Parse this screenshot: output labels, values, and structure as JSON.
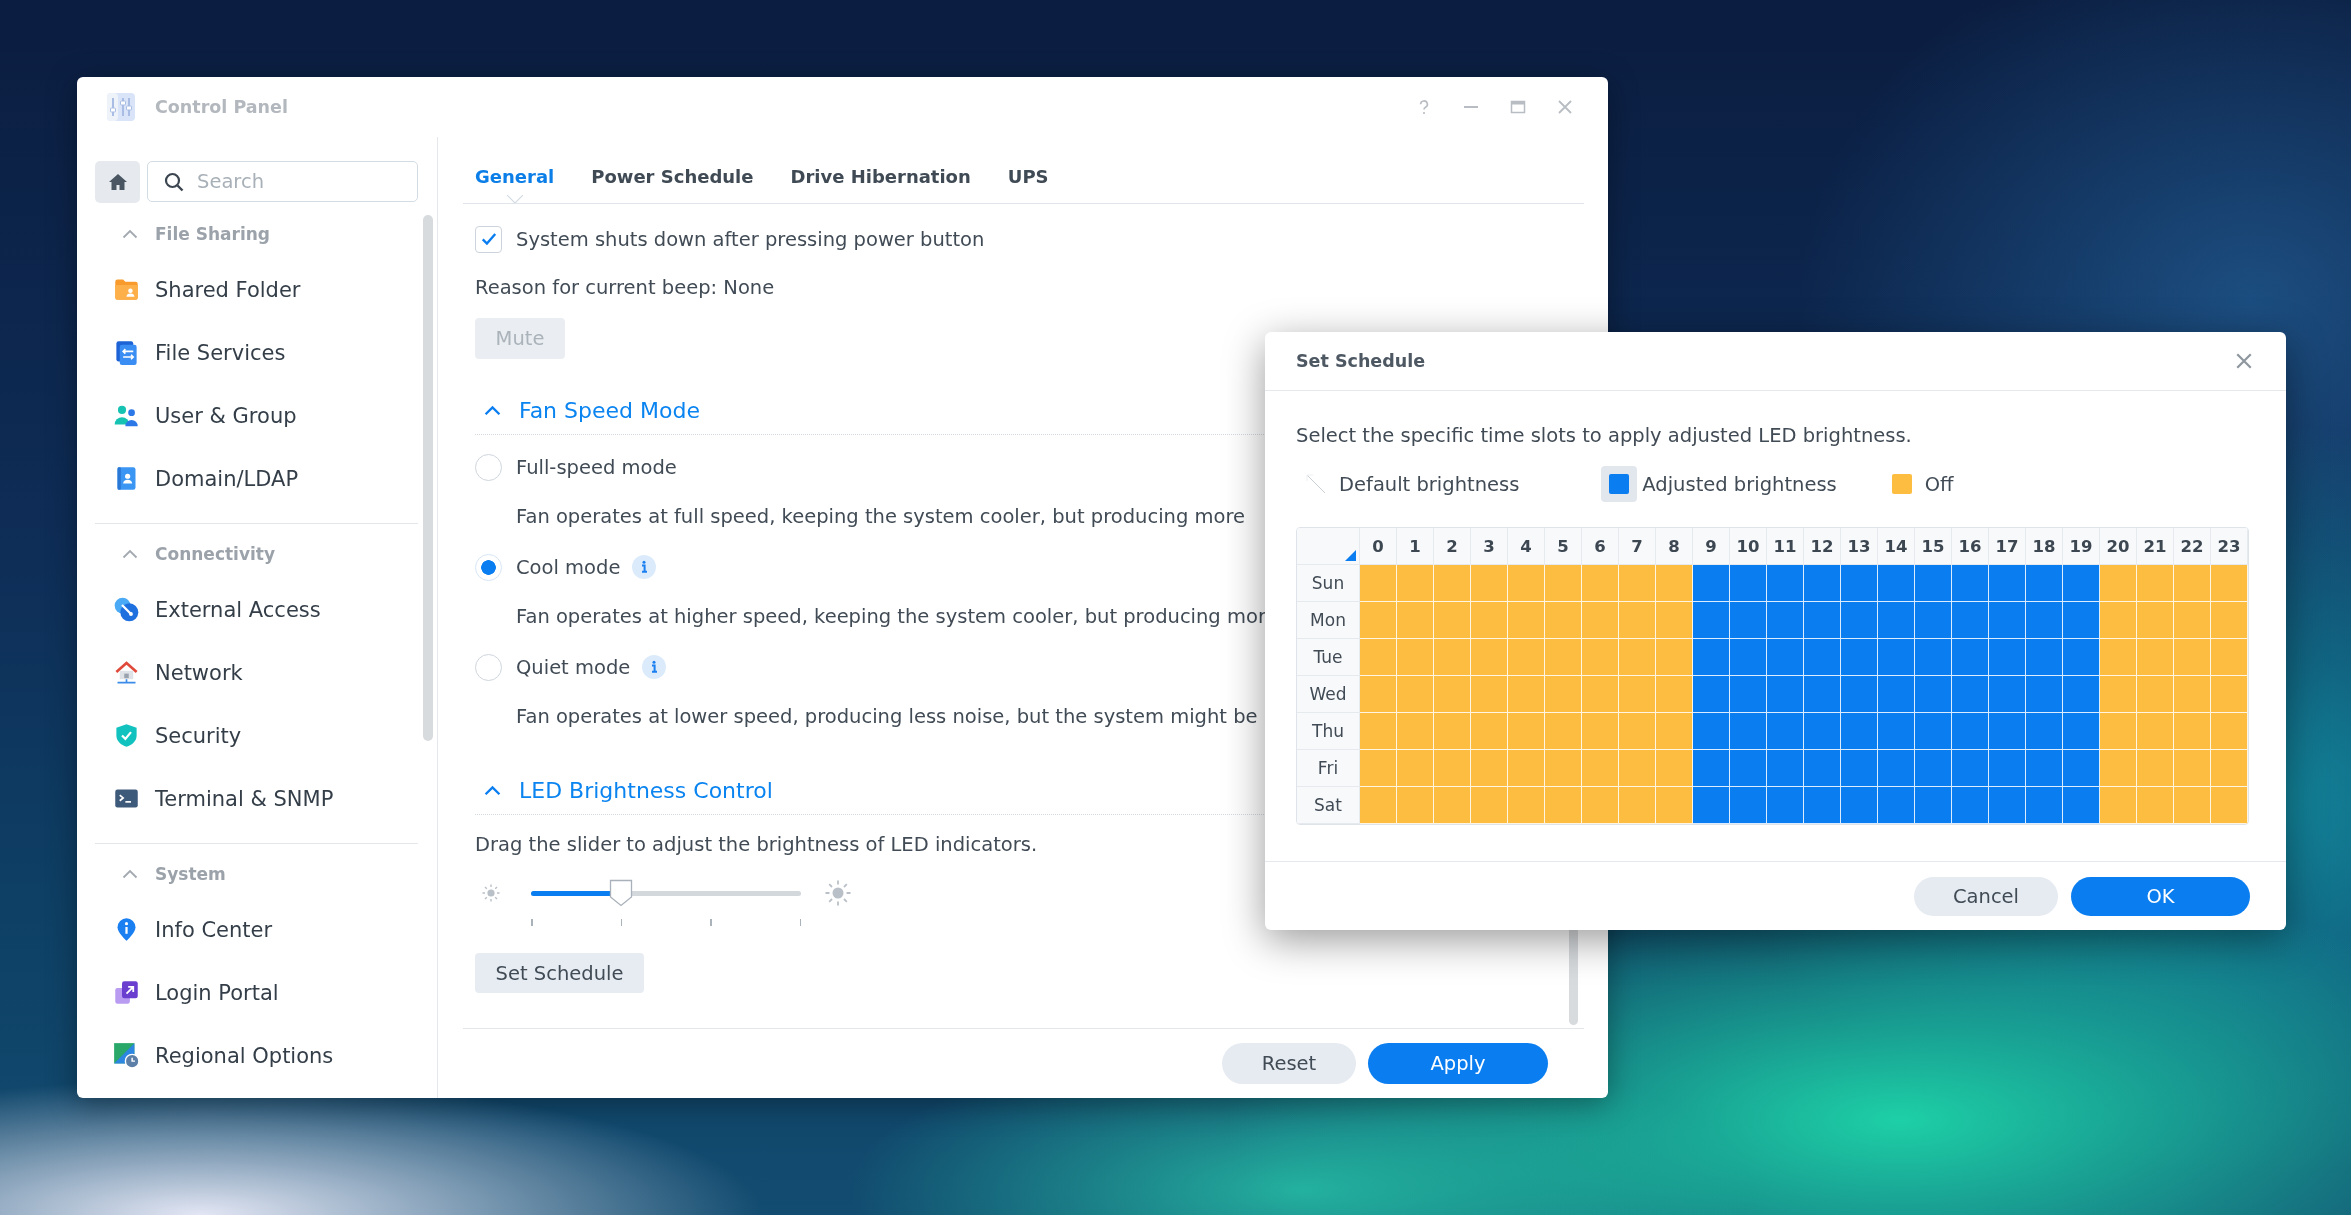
{
  "window": {
    "title": "Control Panel"
  },
  "sidebar": {
    "search": {
      "placeholder": "Search"
    },
    "groups": [
      {
        "label": "File Sharing",
        "expanded": true,
        "items": [
          {
            "label": "Shared Folder",
            "selected": false
          },
          {
            "label": "File Services",
            "selected": false
          },
          {
            "label": "User & Group",
            "selected": false
          },
          {
            "label": "Domain/LDAP",
            "selected": false
          }
        ]
      },
      {
        "label": "Connectivity",
        "expanded": true,
        "items": [
          {
            "label": "External Access",
            "selected": false
          },
          {
            "label": "Network",
            "selected": false
          },
          {
            "label": "Security",
            "selected": false
          },
          {
            "label": "Terminal & SNMP",
            "selected": false
          }
        ]
      },
      {
        "label": "System",
        "expanded": true,
        "items": [
          {
            "label": "Info Center",
            "selected": false
          },
          {
            "label": "Login Portal",
            "selected": false
          },
          {
            "label": "Regional Options",
            "selected": false
          }
        ]
      }
    ]
  },
  "tabs": [
    {
      "label": "General",
      "selected": true
    },
    {
      "label": "Power Schedule",
      "selected": false
    },
    {
      "label": "Drive Hibernation",
      "selected": false
    },
    {
      "label": "UPS",
      "selected": false
    }
  ],
  "general": {
    "power_button": {
      "label": "System shuts down after pressing power button",
      "checked": true
    },
    "beep_reason": "Reason for current beep: None",
    "mute_button": {
      "label": "Mute",
      "disabled": true
    },
    "fan_speed": {
      "title": "Fan Speed Mode",
      "expanded": true,
      "options": [
        {
          "label": "Full-speed mode",
          "info": false,
          "selected": false,
          "description": "Fan operates at full speed, keeping the system cooler, but producing more"
        },
        {
          "label": "Cool mode",
          "info": true,
          "selected": true,
          "description": "Fan operates at higher speed, keeping the system cooler, but producing mor"
        },
        {
          "label": "Quiet mode",
          "info": true,
          "selected": false,
          "description": "Fan operates at lower speed, producing less noise, but the system might be"
        }
      ]
    },
    "led": {
      "title": "LED Brightness Control",
      "expanded": true,
      "hint": "Drag the slider to adjust the brightness of LED indicators.",
      "slider": {
        "level": 0.333
      },
      "schedule_button": "Set Schedule"
    }
  },
  "footer_buttons": [
    {
      "label": "Reset",
      "kind": "secondary"
    },
    {
      "label": "Apply",
      "kind": "primary"
    }
  ],
  "dialog": {
    "title": "Set Schedule",
    "instructions": "Select the specific time slots to apply adjusted LED brightness.",
    "legend": [
      {
        "label": "Default brightness",
        "kind": "default",
        "selected": false
      },
      {
        "label": "Adjusted brightness",
        "kind": "adjusted",
        "selected": true
      },
      {
        "label": "Off",
        "kind": "off",
        "selected": false
      }
    ],
    "hours": [
      "0",
      "1",
      "2",
      "3",
      "4",
      "5",
      "6",
      "7",
      "8",
      "9",
      "10",
      "11",
      "12",
      "13",
      "14",
      "15",
      "16",
      "17",
      "18",
      "19",
      "20",
      "21",
      "22",
      "23"
    ],
    "rows": [
      {
        "day": "Sun",
        "slots": [
          {
            "kind": "off"
          },
          {
            "kind": "off"
          },
          {
            "kind": "off"
          },
          {
            "kind": "off"
          },
          {
            "kind": "off"
          },
          {
            "kind": "off"
          },
          {
            "kind": "off"
          },
          {
            "kind": "off"
          },
          {
            "kind": "off"
          },
          {
            "kind": "adjusted"
          },
          {
            "kind": "adjusted"
          },
          {
            "kind": "adjusted"
          },
          {
            "kind": "adjusted"
          },
          {
            "kind": "adjusted"
          },
          {
            "kind": "adjusted"
          },
          {
            "kind": "adjusted"
          },
          {
            "kind": "adjusted"
          },
          {
            "kind": "adjusted"
          },
          {
            "kind": "adjusted"
          },
          {
            "kind": "adjusted"
          },
          {
            "kind": "off"
          },
          {
            "kind": "off"
          },
          {
            "kind": "off"
          },
          {
            "kind": "off"
          }
        ]
      },
      {
        "day": "Mon",
        "slots": [
          {
            "kind": "off"
          },
          {
            "kind": "off"
          },
          {
            "kind": "off"
          },
          {
            "kind": "off"
          },
          {
            "kind": "off"
          },
          {
            "kind": "off"
          },
          {
            "kind": "off"
          },
          {
            "kind": "off"
          },
          {
            "kind": "off"
          },
          {
            "kind": "adjusted"
          },
          {
            "kind": "adjusted"
          },
          {
            "kind": "adjusted"
          },
          {
            "kind": "adjusted"
          },
          {
            "kind": "adjusted"
          },
          {
            "kind": "adjusted"
          },
          {
            "kind": "adjusted"
          },
          {
            "kind": "adjusted"
          },
          {
            "kind": "adjusted"
          },
          {
            "kind": "adjusted"
          },
          {
            "kind": "adjusted"
          },
          {
            "kind": "off"
          },
          {
            "kind": "off"
          },
          {
            "kind": "off"
          },
          {
            "kind": "off"
          }
        ]
      },
      {
        "day": "Tue",
        "slots": [
          {
            "kind": "off"
          },
          {
            "kind": "off"
          },
          {
            "kind": "off"
          },
          {
            "kind": "off"
          },
          {
            "kind": "off"
          },
          {
            "kind": "off"
          },
          {
            "kind": "off"
          },
          {
            "kind": "off"
          },
          {
            "kind": "off"
          },
          {
            "kind": "adjusted"
          },
          {
            "kind": "adjusted"
          },
          {
            "kind": "adjusted"
          },
          {
            "kind": "adjusted"
          },
          {
            "kind": "adjusted"
          },
          {
            "kind": "adjusted"
          },
          {
            "kind": "adjusted"
          },
          {
            "kind": "adjusted"
          },
          {
            "kind": "adjusted"
          },
          {
            "kind": "adjusted"
          },
          {
            "kind": "adjusted"
          },
          {
            "kind": "off"
          },
          {
            "kind": "off"
          },
          {
            "kind": "off"
          },
          {
            "kind": "off"
          }
        ]
      },
      {
        "day": "Wed",
        "slots": [
          {
            "kind": "off"
          },
          {
            "kind": "off"
          },
          {
            "kind": "off"
          },
          {
            "kind": "off"
          },
          {
            "kind": "off"
          },
          {
            "kind": "off"
          },
          {
            "kind": "off"
          },
          {
            "kind": "off"
          },
          {
            "kind": "off"
          },
          {
            "kind": "adjusted"
          },
          {
            "kind": "adjusted"
          },
          {
            "kind": "adjusted"
          },
          {
            "kind": "adjusted"
          },
          {
            "kind": "adjusted"
          },
          {
            "kind": "adjusted"
          },
          {
            "kind": "adjusted"
          },
          {
            "kind": "adjusted"
          },
          {
            "kind": "adjusted"
          },
          {
            "kind": "adjusted"
          },
          {
            "kind": "adjusted"
          },
          {
            "kind": "off"
          },
          {
            "kind": "off"
          },
          {
            "kind": "off"
          },
          {
            "kind": "off"
          }
        ]
      },
      {
        "day": "Thu",
        "slots": [
          {
            "kind": "off"
          },
          {
            "kind": "off"
          },
          {
            "kind": "off"
          },
          {
            "kind": "off"
          },
          {
            "kind": "off"
          },
          {
            "kind": "off"
          },
          {
            "kind": "off"
          },
          {
            "kind": "off"
          },
          {
            "kind": "off"
          },
          {
            "kind": "adjusted"
          },
          {
            "kind": "adjusted"
          },
          {
            "kind": "adjusted"
          },
          {
            "kind": "adjusted"
          },
          {
            "kind": "adjusted"
          },
          {
            "kind": "adjusted"
          },
          {
            "kind": "adjusted"
          },
          {
            "kind": "adjusted"
          },
          {
            "kind": "adjusted"
          },
          {
            "kind": "adjusted"
          },
          {
            "kind": "adjusted"
          },
          {
            "kind": "off"
          },
          {
            "kind": "off"
          },
          {
            "kind": "off"
          },
          {
            "kind": "off"
          }
        ]
      },
      {
        "day": "Fri",
        "slots": [
          {
            "kind": "off"
          },
          {
            "kind": "off"
          },
          {
            "kind": "off"
          },
          {
            "kind": "off"
          },
          {
            "kind": "off"
          },
          {
            "kind": "off"
          },
          {
            "kind": "off"
          },
          {
            "kind": "off"
          },
          {
            "kind": "off"
          },
          {
            "kind": "adjusted"
          },
          {
            "kind": "adjusted"
          },
          {
            "kind": "adjusted"
          },
          {
            "kind": "adjusted"
          },
          {
            "kind": "adjusted"
          },
          {
            "kind": "adjusted"
          },
          {
            "kind": "adjusted"
          },
          {
            "kind": "adjusted"
          },
          {
            "kind": "adjusted"
          },
          {
            "kind": "adjusted"
          },
          {
            "kind": "adjusted"
          },
          {
            "kind": "off"
          },
          {
            "kind": "off"
          },
          {
            "kind": "off"
          },
          {
            "kind": "off"
          }
        ]
      },
      {
        "day": "Sat",
        "slots": [
          {
            "kind": "off"
          },
          {
            "kind": "off"
          },
          {
            "kind": "off"
          },
          {
            "kind": "off"
          },
          {
            "kind": "off"
          },
          {
            "kind": "off"
          },
          {
            "kind": "off"
          },
          {
            "kind": "off"
          },
          {
            "kind": "off"
          },
          {
            "kind": "adjusted"
          },
          {
            "kind": "adjusted"
          },
          {
            "kind": "adjusted"
          },
          {
            "kind": "adjusted"
          },
          {
            "kind": "adjusted"
          },
          {
            "kind": "adjusted"
          },
          {
            "kind": "adjusted"
          },
          {
            "kind": "adjusted"
          },
          {
            "kind": "adjusted"
          },
          {
            "kind": "adjusted"
          },
          {
            "kind": "adjusted"
          },
          {
            "kind": "off"
          },
          {
            "kind": "off"
          },
          {
            "kind": "off"
          },
          {
            "kind": "off"
          }
        ]
      }
    ],
    "buttons": [
      {
        "label": "Cancel",
        "kind": "secondary"
      },
      {
        "label": "OK",
        "kind": "primary"
      }
    ]
  }
}
